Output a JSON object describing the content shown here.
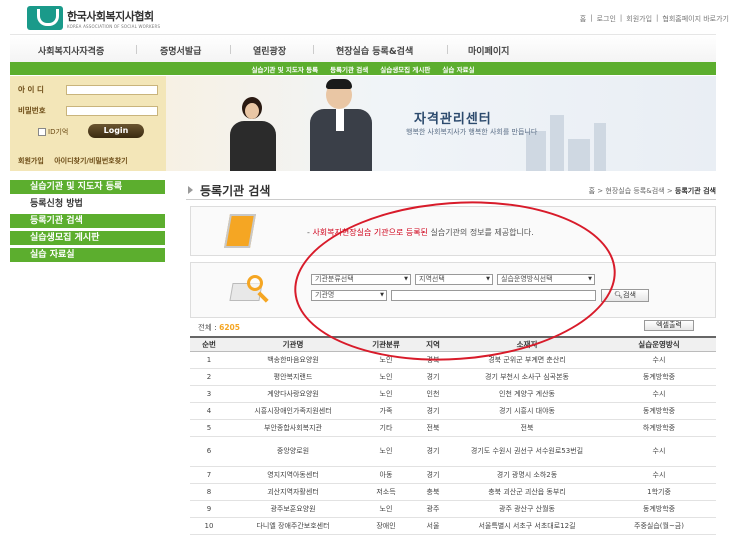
{
  "header": {
    "logo_title": "한국사회복지사협회",
    "logo_subtitle": "KOREA ASSOCIATION OF SOCIAL WORKERS",
    "top_links": [
      "홈",
      "|",
      "로그인",
      "|",
      "회원가입",
      "|",
      "협회홈페이지 바로가기"
    ]
  },
  "nav": {
    "items": [
      "사회복지사자격증",
      "증명서발급",
      "열린광장",
      "현장실습 등록&검색",
      "마이페이지"
    ]
  },
  "subnav": {
    "items": [
      "실습기관 및 지도자 등록",
      "등록기관 검색",
      "실습생모집 게시판",
      "실습 자료실"
    ]
  },
  "login": {
    "id_label": "아 이 디",
    "pw_label": "비밀번호",
    "remember_label": "ID기억",
    "login_button": "Login",
    "signup_link": "회원가입",
    "find_link": "아이디찾기/비밀번호찾기"
  },
  "banner": {
    "title": "자격관리센터",
    "subtitle": "행복한 사회복지사가 행복한 사회를 만듭니다"
  },
  "sidebar": {
    "items": [
      "실습기관 및 지도자 등록",
      "등록신청 방법",
      "등록기관 검색",
      "실습생모집 게시판",
      "실습 자료실"
    ]
  },
  "content": {
    "page_title": "등록기관 검색",
    "breadcrumb_home": "홈",
    "breadcrumb_mid": "현장실습 등록&검색",
    "breadcrumb_current": "등록기관 검색",
    "info_prefix": "- ",
    "info_highlight": "사회복지현장실습 기관으로 등록된",
    "info_rest": " 실습기관의 정보를 제공합니다.",
    "select_category": "기관분류선택",
    "select_region": "지역선택",
    "select_method": "실습운영방식선택",
    "select_field": "기관명",
    "search_button": "검색",
    "total_label": "전체 : ",
    "total_count": "6205",
    "excel_button": "엑셀출력"
  },
  "table": {
    "headers": [
      "순번",
      "기관명",
      "기관분류",
      "지역",
      "소재지",
      "실습운영방식"
    ],
    "rows": [
      [
        "1",
        "백송한마음요양원",
        "노인",
        "경북",
        "경북 군위군 부계면 춘산리",
        "수시"
      ],
      [
        "2",
        "평안복지랜드",
        "노인",
        "경기",
        "경기 부천시 소사구 심곡본동",
        "동계방학중"
      ],
      [
        "3",
        "계양다사랑요양원",
        "노인",
        "인천",
        "인천 계양구 계산동",
        "수시"
      ],
      [
        "4",
        "시흥시장애인가족지원센터",
        "가족",
        "경기",
        "경기 시흥시 대야동",
        "동계방학중"
      ],
      [
        "5",
        "부안종합사회복지관",
        "기타",
        "전북",
        "전북",
        "하계방학중"
      ],
      [
        "6",
        "중앙양로원",
        "노인",
        "경기",
        "경기도 수원시 권선구 서수원로53번길",
        "수시"
      ],
      [
        "7",
        "영지지역아동센터",
        "아동",
        "경기",
        "경기 광명시 소하2동",
        "수시"
      ],
      [
        "8",
        "괴산지역자활센터",
        "저소득",
        "충북",
        "충북 괴산군 괴산읍 동부리",
        "1학기중"
      ],
      [
        "9",
        "광주보훈요양원",
        "노인",
        "광주",
        "광주 광산구 산월동",
        "동계방학중"
      ],
      [
        "10",
        "다니엘 장애주간보호센터",
        "장애인",
        "서울",
        "서울특별시 서초구 서초대로12길",
        "주중실습(월~금)"
      ]
    ]
  },
  "colors": {
    "green": "#5cae2e",
    "login_bg": "#f3e6b8",
    "highlight_red": "#d0021b",
    "annotation_red": "#d81b2a",
    "count_orange": "#f5a623"
  }
}
